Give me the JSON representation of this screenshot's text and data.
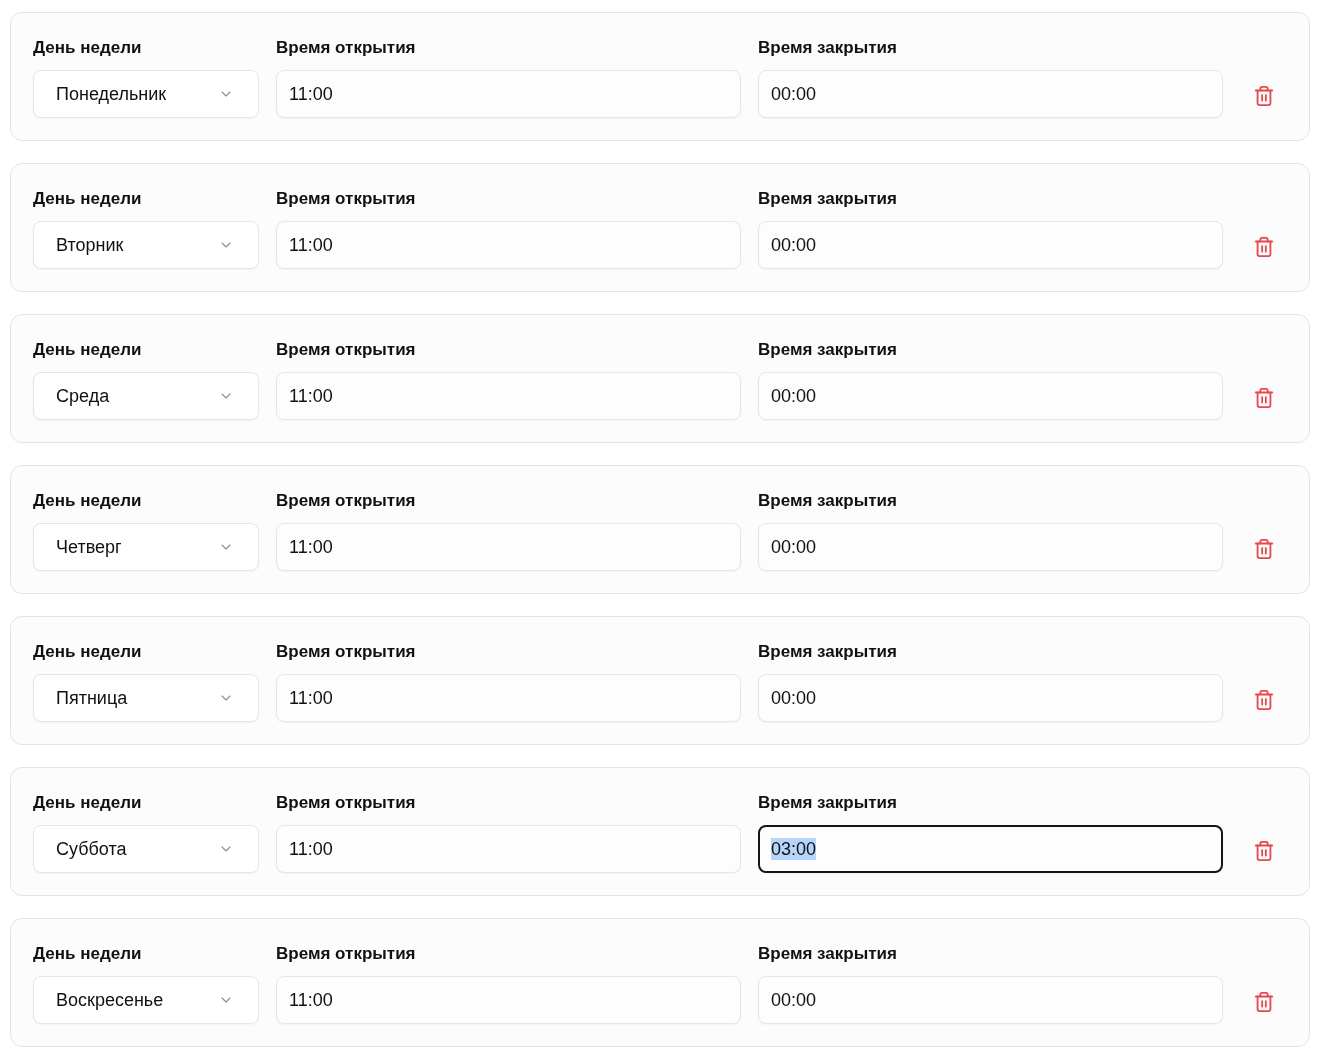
{
  "schedule": [
    {
      "day_field": {
        "label": "День недели",
        "value": "Понедельник"
      },
      "open_field": {
        "label": "Время открытия",
        "value": "11:00",
        "focused": false
      },
      "close_field": {
        "label": "Время закрытия",
        "value": "00:00",
        "focused": false
      }
    },
    {
      "day_field": {
        "label": "День недели",
        "value": "Вторник"
      },
      "open_field": {
        "label": "Время открытия",
        "value": "11:00",
        "focused": false
      },
      "close_field": {
        "label": "Время закрытия",
        "value": "00:00",
        "focused": false
      }
    },
    {
      "day_field": {
        "label": "День недели",
        "value": "Среда"
      },
      "open_field": {
        "label": "Время открытия",
        "value": "11:00",
        "focused": false
      },
      "close_field": {
        "label": "Время закрытия",
        "value": "00:00",
        "focused": false
      }
    },
    {
      "day_field": {
        "label": "День недели",
        "value": "Четверг"
      },
      "open_field": {
        "label": "Время открытия",
        "value": "11:00",
        "focused": false
      },
      "close_field": {
        "label": "Время закрытия",
        "value": "00:00",
        "focused": false
      }
    },
    {
      "day_field": {
        "label": "День недели",
        "value": "Пятница"
      },
      "open_field": {
        "label": "Время открытия",
        "value": "11:00",
        "focused": false
      },
      "close_field": {
        "label": "Время закрытия",
        "value": "00:00",
        "focused": false
      }
    },
    {
      "day_field": {
        "label": "День недели",
        "value": "Суббота"
      },
      "open_field": {
        "label": "Время открытия",
        "value": "11:00",
        "focused": false
      },
      "close_field": {
        "label": "Время закрытия",
        "value": "03:00",
        "focused": true
      }
    },
    {
      "day_field": {
        "label": "День недели",
        "value": "Воскресенье"
      },
      "open_field": {
        "label": "Время открытия",
        "value": "11:00",
        "focused": false
      },
      "close_field": {
        "label": "Время закрытия",
        "value": "00:00",
        "focused": false
      }
    }
  ]
}
